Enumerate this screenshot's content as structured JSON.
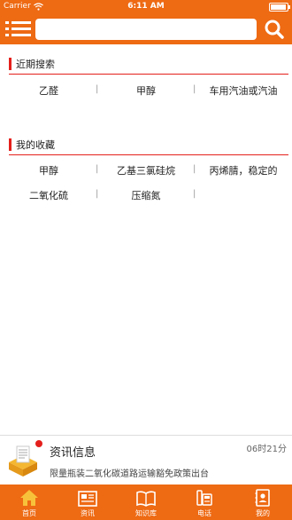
{
  "status_bar": {
    "carrier": "Carrier",
    "time": "6:11 AM"
  },
  "search": {
    "placeholder": "",
    "value": ""
  },
  "recent_search": {
    "title": "近期搜索",
    "items": [
      "乙醛",
      "甲醇",
      "车用汽油或汽油"
    ]
  },
  "favorites": {
    "title": "我的收藏",
    "items": [
      "甲醇",
      "乙基三氯硅烷",
      "丙烯腈，稳定的",
      "二氧化硫",
      "压缩氮"
    ]
  },
  "separator": "|",
  "news": {
    "title": "资讯信息",
    "time": "06时21分",
    "text": "限量瓶装二氧化碳道路运输豁免政策出台"
  },
  "tabs": [
    "首页",
    "资讯",
    "知识库",
    "电话",
    "我的"
  ],
  "colors": {
    "brand": "#ee6a13",
    "accent": "#e4201c"
  },
  "icons": [
    "wifi-icon",
    "battery-icon",
    "menu-icon",
    "search-icon",
    "news-icon",
    "home-icon",
    "newspaper-icon",
    "book-icon",
    "phone-icon",
    "contacts-icon"
  ]
}
